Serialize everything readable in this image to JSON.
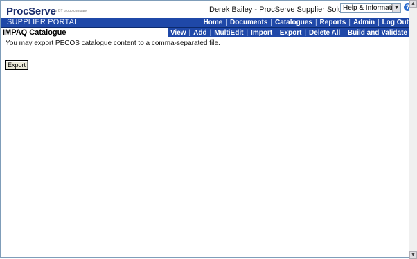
{
  "header": {
    "logo_text": "ProcServe",
    "logo_subtext": "a BT group company",
    "user_info": "Derek Bailey - ProcServe Supplier Solutions Limited",
    "help_select_value": "Help & Information...",
    "help_icon": "question-icon"
  },
  "portal": {
    "title": "SUPPLIER PORTAL",
    "nav": [
      "Home",
      "Documents",
      "Catalogues",
      "Reports",
      "Admin",
      "Log Out"
    ]
  },
  "page": {
    "title": "IMPAQ Catalogue",
    "subnav": [
      "View",
      "Add",
      "MultiEdit",
      "Import",
      "Export",
      "Delete All",
      "Build and Validate"
    ],
    "description": "You may export PECOS catalogue content to a comma-separated file.",
    "export_button": "Export"
  }
}
